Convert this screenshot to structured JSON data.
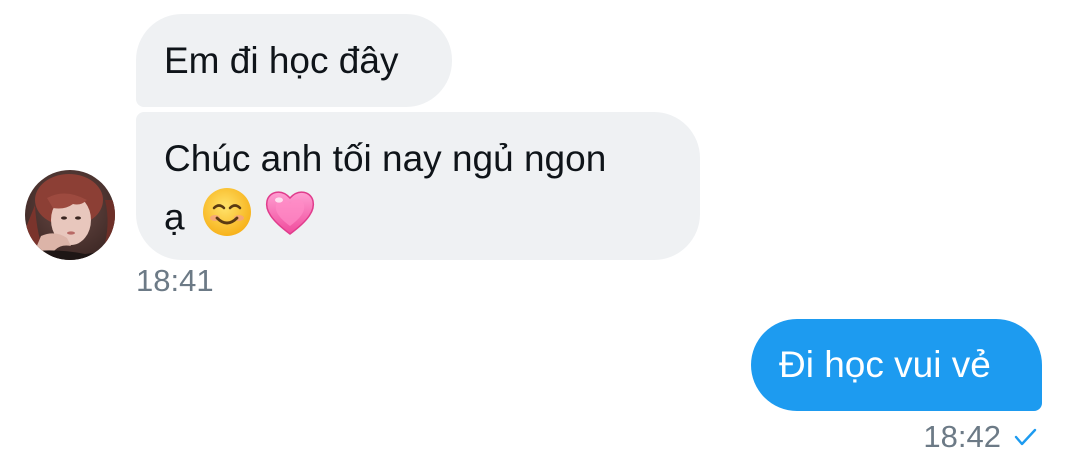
{
  "conversation": {
    "messages": [
      {
        "direction": "incoming",
        "text": "Em đi học đây"
      },
      {
        "direction": "incoming",
        "text_line1": "Chúc anh tối nay ngủ ngon",
        "text_line2": "ạ",
        "emojis": [
          "smiling-face-emoji",
          "heart-emoji"
        ]
      },
      {
        "direction": "outgoing",
        "text": "Đi học vui vẻ"
      }
    ],
    "incoming_timestamp": "18:41",
    "outgoing_timestamp": "18:42",
    "outgoing_status_icon": "check-icon"
  },
  "colors": {
    "incoming_bubble": "#eff1f3",
    "outgoing_bubble": "#1d9bf0",
    "timestamp": "#6c7a86"
  }
}
